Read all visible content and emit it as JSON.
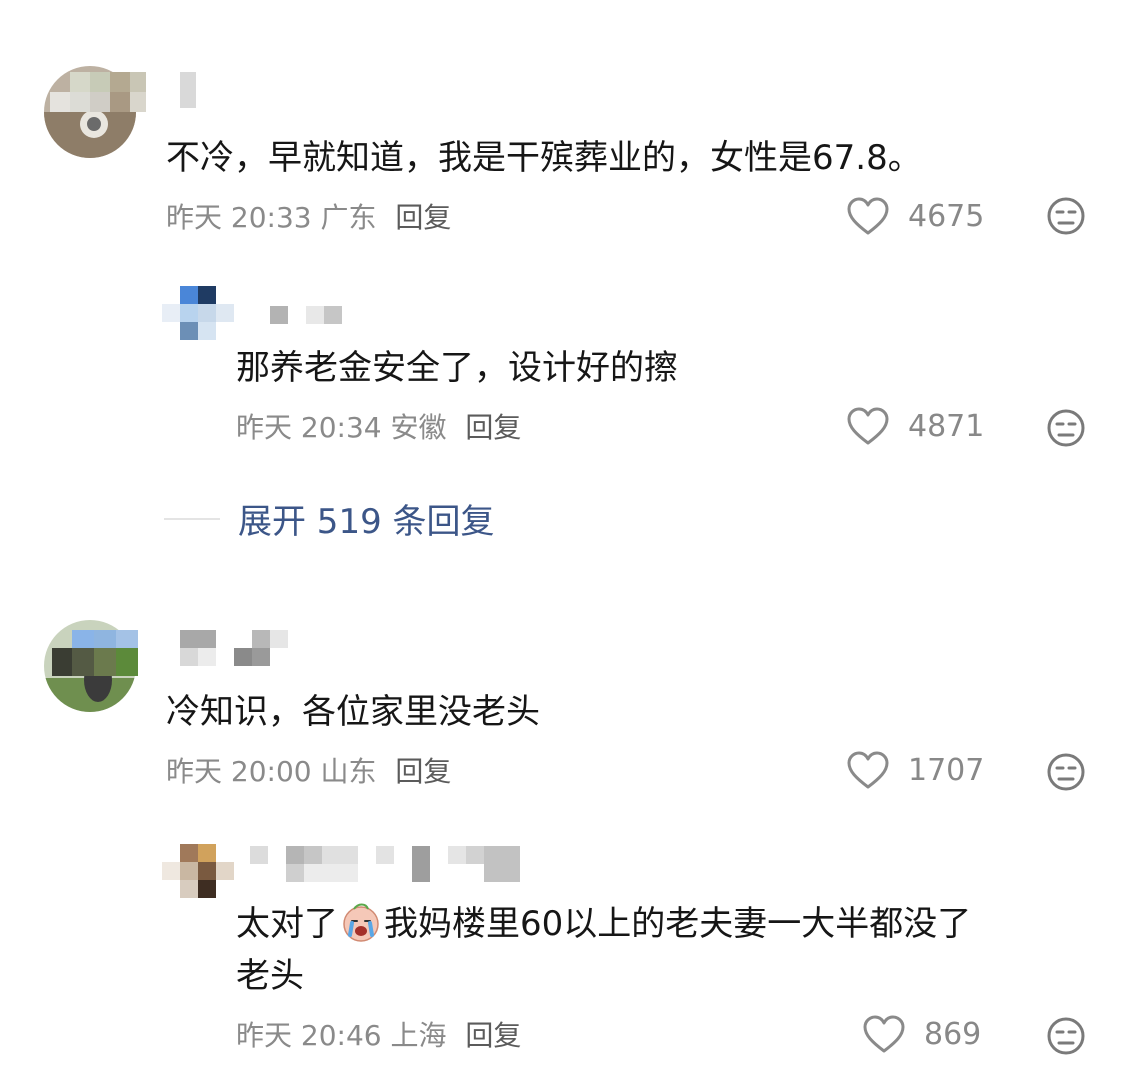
{
  "comments": [
    {
      "text": "不冷，早就知道，我是干殡葬业的，女性是67.8。",
      "time": "昨天 20:33",
      "location": "广东",
      "reply_label": "回复",
      "likes": "4675"
    },
    {
      "text": "那养老金安全了，设计好的擦",
      "time": "昨天 20:34",
      "location": "安徽",
      "reply_label": "回复",
      "likes": "4871"
    },
    {
      "text": "冷知识，各位家里没老头",
      "time": "昨天 20:00",
      "location": "山东",
      "reply_label": "回复",
      "likes": "1707"
    },
    {
      "text_before_emoji": "太对了",
      "text_after_emoji": "我妈楼里60以上的老夫妻一大半都没了",
      "text_line2": "老头",
      "time": "昨天 20:46",
      "location": "上海",
      "reply_label": "回复",
      "likes": "869"
    }
  ],
  "expand_replies": "展开 519 条回复",
  "icons": {
    "like": "heart-outline-icon",
    "dislike": "meh-face-icon",
    "emoji": "crying-face-emoji"
  },
  "colors": {
    "text": "#161616",
    "meta": "#8a8a8a",
    "link": "#3c5688"
  }
}
